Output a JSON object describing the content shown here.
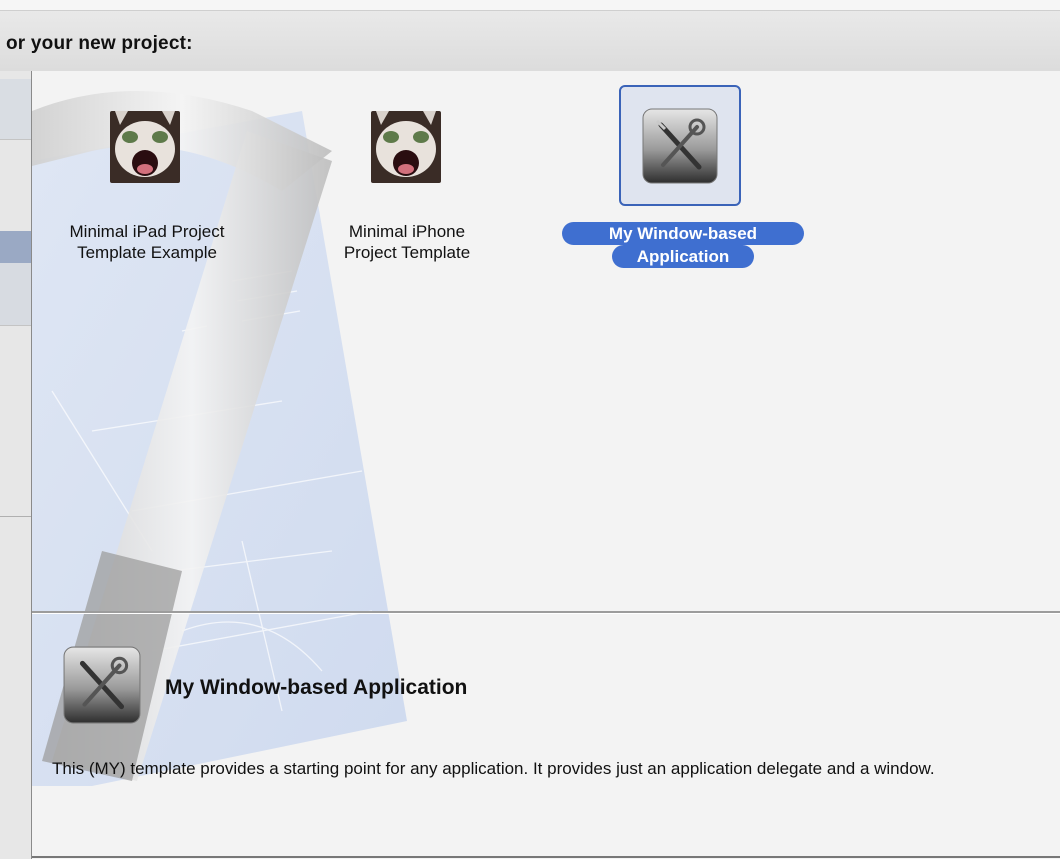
{
  "header": {
    "title": "or your new project:"
  },
  "templates": [
    {
      "label_line1": "Minimal iPad Project",
      "label_line2": "Template Example",
      "icon": "cat-photo-icon"
    },
    {
      "label_line1": "Minimal iPhone",
      "label_line2": "Project Template",
      "icon": "cat-photo-icon"
    },
    {
      "label_line1": "My Window-based",
      "label_line2": "Application",
      "icon": "wrench-screwdriver-icon",
      "selected": true
    }
  ],
  "detail": {
    "title": "My Window-based Application",
    "description": "This (MY) template provides a starting point for any application. It provides just an application delegate and a window.",
    "icon": "wrench-screwdriver-icon"
  },
  "colors": {
    "selection": "#3f6fd0",
    "selection_border": "#3a63b8",
    "background": "#f3f3f3"
  }
}
